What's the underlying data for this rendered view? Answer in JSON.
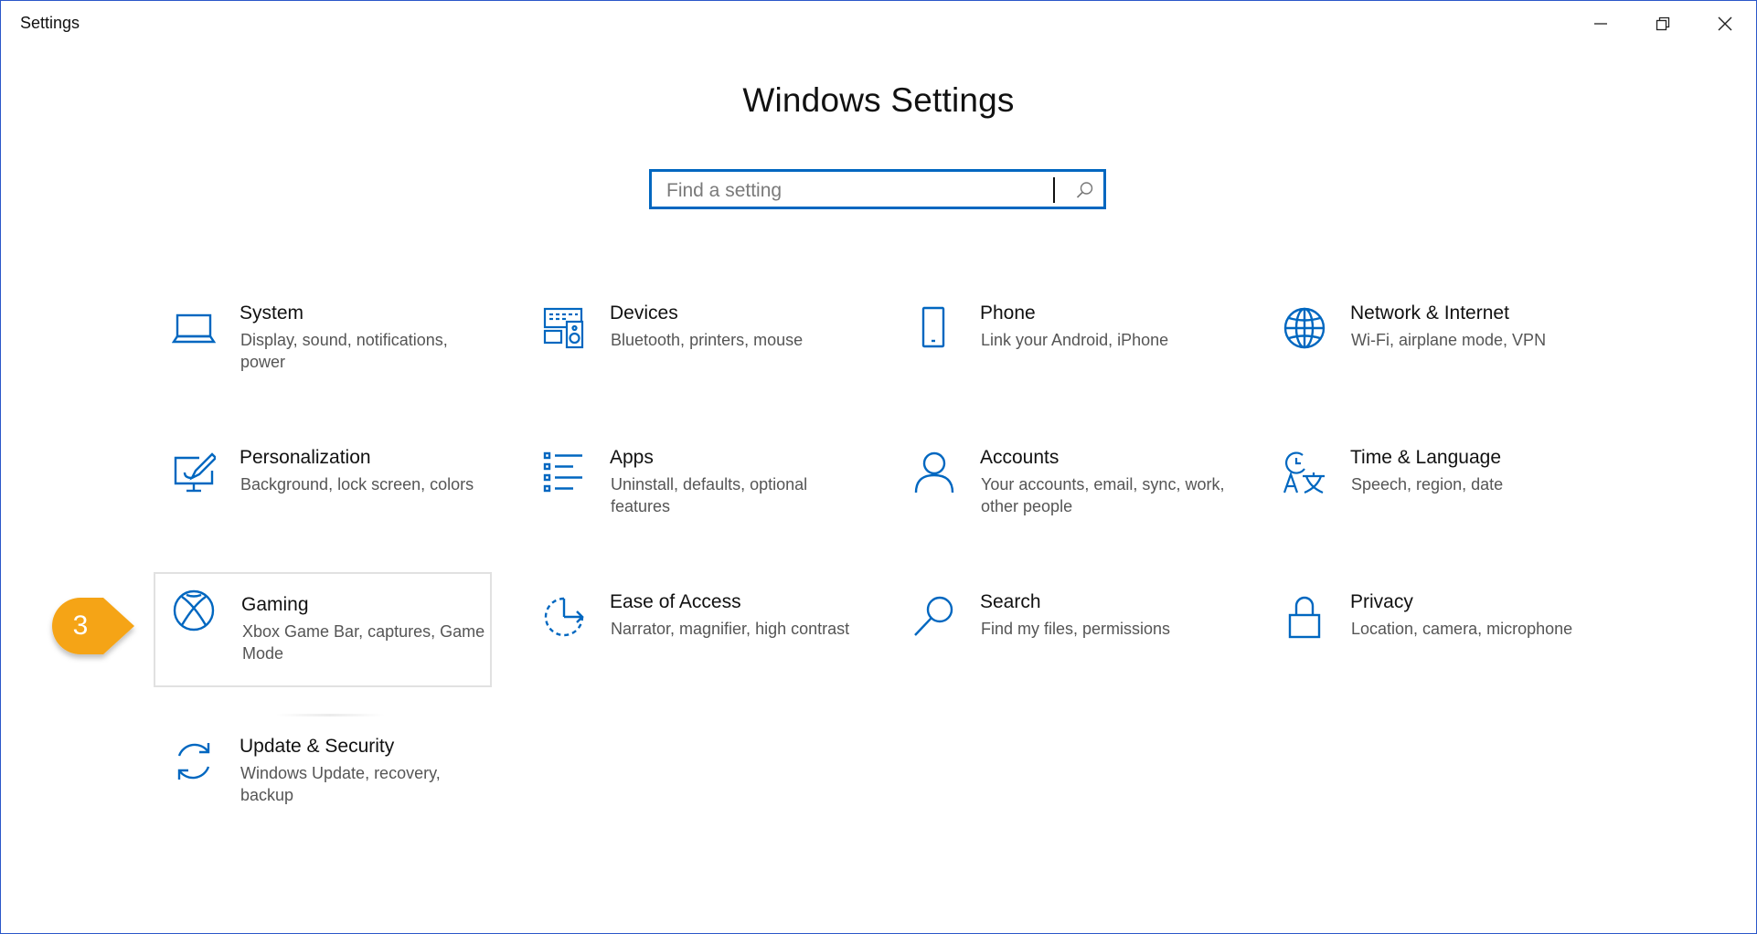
{
  "window": {
    "title": "Settings",
    "border_color": "#2b57c9"
  },
  "titlebar_controls": [
    "minimize-icon",
    "restore-icon",
    "close-icon"
  ],
  "page": {
    "title": "Windows Settings"
  },
  "search": {
    "placeholder": "Find a setting",
    "value": "",
    "icon": "search-icon",
    "border_color": "#0067c0"
  },
  "accent_color": "#0067c0",
  "categories": [
    {
      "name": "System",
      "desc": "Display, sound, notifications, power",
      "icon": "laptop-icon"
    },
    {
      "name": "Devices",
      "desc": "Bluetooth, printers, mouse",
      "icon": "keyboard-speaker-icon"
    },
    {
      "name": "Phone",
      "desc": "Link your Android, iPhone",
      "icon": "phone-icon"
    },
    {
      "name": "Network & Internet",
      "desc": "Wi-Fi, airplane mode, VPN",
      "icon": "globe-icon"
    },
    {
      "name": "Personalization",
      "desc": "Background, lock screen, colors",
      "icon": "paint-monitor-icon"
    },
    {
      "name": "Apps",
      "desc": "Uninstall, defaults, optional features",
      "icon": "apps-list-icon"
    },
    {
      "name": "Accounts",
      "desc": "Your accounts, email, sync, work, other people",
      "icon": "person-icon"
    },
    {
      "name": "Time & Language",
      "desc": "Speech, region, date",
      "icon": "time-language-icon"
    },
    {
      "name": "Gaming",
      "desc": "Xbox Game Bar, captures, Game Mode",
      "icon": "xbox-icon",
      "hovered": true
    },
    {
      "name": "Ease of Access",
      "desc": "Narrator, magnifier, high contrast",
      "icon": "ease-of-access-icon"
    },
    {
      "name": "Search",
      "desc": "Find my files, permissions",
      "icon": "magnifier-icon"
    },
    {
      "name": "Privacy",
      "desc": "Location, camera, microphone",
      "icon": "lock-icon"
    },
    {
      "name": "Update & Security",
      "desc": "Windows Update, recovery, backup",
      "icon": "sync-icon"
    }
  ],
  "callout": {
    "number": "3",
    "color": "#f5a416"
  }
}
